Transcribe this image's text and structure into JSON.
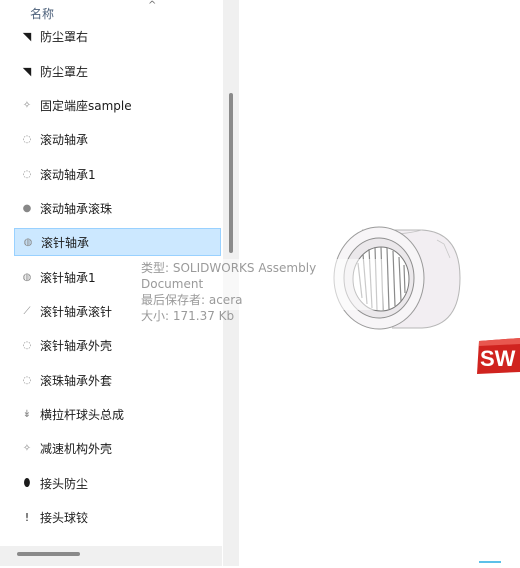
{
  "file_list": {
    "column_header": "名称",
    "items": [
      {
        "name": "防尘罩右",
        "icon": "part-dark-icon",
        "selected": false
      },
      {
        "name": "防尘罩左",
        "icon": "part-dark-icon",
        "selected": false
      },
      {
        "name": "固定端座sample",
        "icon": "part-icon",
        "selected": false
      },
      {
        "name": "滚动轴承",
        "icon": "part-icon",
        "selected": false
      },
      {
        "name": "滚动轴承1",
        "icon": "part-icon",
        "selected": false
      },
      {
        "name": "滚动轴承滚珠",
        "icon": "part-icon",
        "selected": false
      },
      {
        "name": "滚针轴承",
        "icon": "assembly-icon",
        "selected": true
      },
      {
        "name": "滚针轴承1",
        "icon": "part-icon",
        "selected": false
      },
      {
        "name": "滚针轴承滚针",
        "icon": "part-icon",
        "selected": false
      },
      {
        "name": "滚针轴承外壳",
        "icon": "part-icon",
        "selected": false
      },
      {
        "name": "滚珠轴承外套",
        "icon": "part-icon",
        "selected": false
      },
      {
        "name": "横拉杆球头总成",
        "icon": "part-icon",
        "selected": false
      },
      {
        "name": "减速机构外壳",
        "icon": "part-icon",
        "selected": false
      },
      {
        "name": "接头防尘",
        "icon": "part-dark-icon",
        "selected": false
      },
      {
        "name": "接头球铰",
        "icon": "part-dark-icon",
        "selected": false
      }
    ]
  },
  "tooltip": {
    "type_line": "类型: SOLIDWORKS Assembly Document",
    "saved_by_line": "最后保存者: acera",
    "size_line": "大小: 171.37 Kb"
  },
  "preview": {
    "logo_letters": "SW",
    "logo_color": "#d0231f"
  },
  "colors": {
    "selection_bg": "#cce8ff",
    "selection_border": "#99d1ff"
  }
}
